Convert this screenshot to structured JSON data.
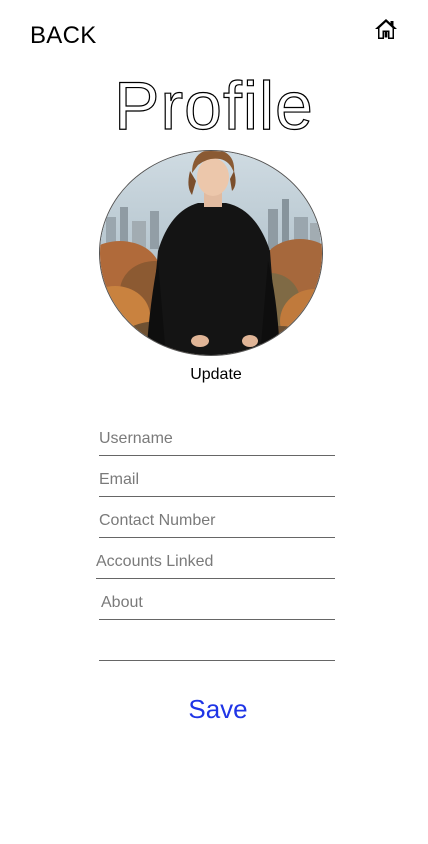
{
  "header": {
    "back_label": "BACK",
    "home_icon": "home-icon"
  },
  "page": {
    "title": "Profile"
  },
  "avatar": {
    "update_label": "Update"
  },
  "form": {
    "username": {
      "placeholder": "Username",
      "value": ""
    },
    "email": {
      "placeholder": "Email",
      "value": ""
    },
    "contact": {
      "placeholder": "Contact Number",
      "value": ""
    },
    "accounts": {
      "placeholder": "Accounts Linked",
      "value": ""
    },
    "about": {
      "placeholder": "About",
      "value": ""
    },
    "extra": {
      "placeholder": "",
      "value": ""
    }
  },
  "actions": {
    "save_label": "Save"
  },
  "colors": {
    "save": "#1f35e6",
    "text": "#000000"
  }
}
